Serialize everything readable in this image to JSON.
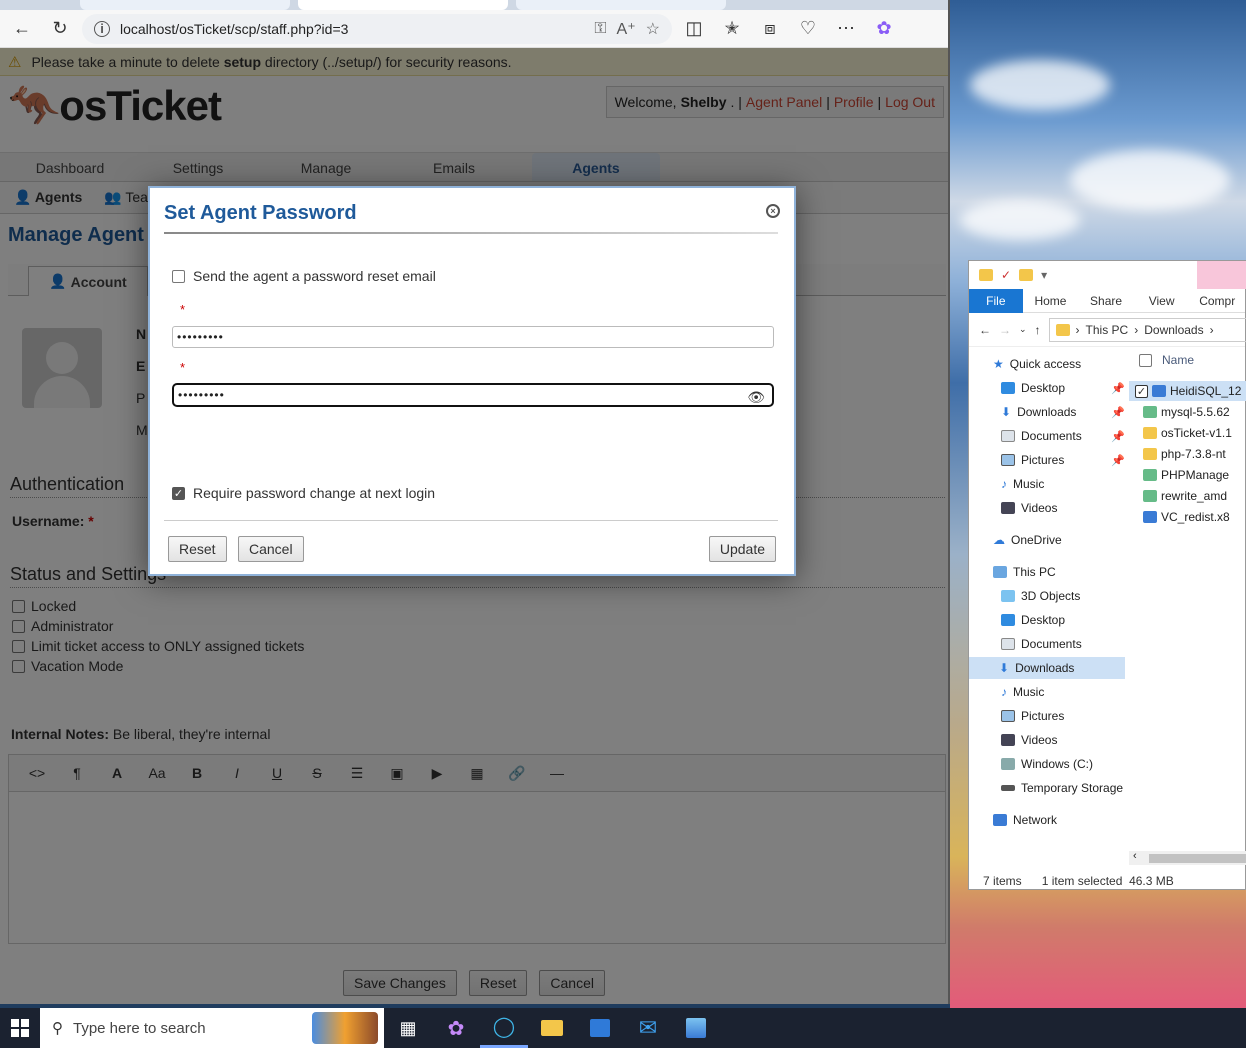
{
  "browser": {
    "url": "localhost/osTicket/scp/staff.php?id=3"
  },
  "osticket": {
    "warning": {
      "prefix": "Please take a minute to delete ",
      "bold": "setup",
      "suffix": " directory (../setup/) for security reasons."
    },
    "logo": "osTicket",
    "welcome": {
      "prefix": "Welcome, ",
      "user": "Shelby",
      "agent_panel": "Agent Panel",
      "profile": "Profile",
      "logout": "Log Out"
    },
    "nav": [
      "Dashboard",
      "Settings",
      "Manage",
      "Emails",
      "Agents"
    ],
    "subnav": [
      "Agents",
      "Tea"
    ],
    "page_title": "Manage Agent",
    "tab_account": "Account",
    "authentication": "Authentication",
    "username_label": "Username:",
    "status_settings": "Status and Settings",
    "checkboxes": [
      "Locked",
      "Administrator",
      "Limit ticket access to ONLY assigned tickets",
      "Vacation Mode"
    ],
    "internal_notes_label": "Internal Notes:",
    "internal_notes_hint": "Be liberal, they're internal",
    "buttons": {
      "save": "Save Changes",
      "reset": "Reset",
      "cancel": "Cancel"
    }
  },
  "modal": {
    "title": "Set Agent Password",
    "send_email": "Send the agent a password reset email",
    "send_email_checked": false,
    "password1": "•••••••••",
    "password2": "•••••••••",
    "require_change": "Require password change at next login",
    "require_change_checked": true,
    "reset": "Reset",
    "cancel": "Cancel",
    "update": "Update"
  },
  "explorer": {
    "ribbon": [
      "File",
      "Home",
      "Share",
      "View",
      "Compr"
    ],
    "path": [
      "This PC",
      "Downloads"
    ],
    "nav": [
      {
        "label": "Quick access",
        "pinned": false
      },
      {
        "label": "Desktop",
        "pinned": true
      },
      {
        "label": "Downloads",
        "pinned": true
      },
      {
        "label": "Documents",
        "pinned": true
      },
      {
        "label": "Pictures",
        "pinned": true
      },
      {
        "label": "Music",
        "pinned": false
      },
      {
        "label": "Videos",
        "pinned": false
      },
      {
        "label": "OneDrive",
        "pinned": false
      },
      {
        "label": "This PC",
        "pinned": false
      },
      {
        "label": "3D Objects",
        "pinned": false
      },
      {
        "label": "Desktop",
        "pinned": false
      },
      {
        "label": "Documents",
        "pinned": false
      },
      {
        "label": "Downloads",
        "pinned": false
      },
      {
        "label": "Music",
        "pinned": false
      },
      {
        "label": "Pictures",
        "pinned": false
      },
      {
        "label": "Videos",
        "pinned": false
      },
      {
        "label": "Windows (C:)",
        "pinned": false
      },
      {
        "label": "Temporary Storage",
        "pinned": false
      },
      {
        "label": "Network",
        "pinned": false
      }
    ],
    "column_name": "Name",
    "files": [
      "HeidiSQL_12",
      "mysql-5.5.62",
      "osTicket-v1.1",
      "php-7.3.8-nt",
      "PHPManage",
      "rewrite_amd",
      "VC_redist.x8"
    ],
    "status": {
      "items": "7 items",
      "selected": "1 item selected",
      "size": "46.3 MB"
    }
  },
  "taskbar": {
    "search_placeholder": "Type here to search"
  }
}
